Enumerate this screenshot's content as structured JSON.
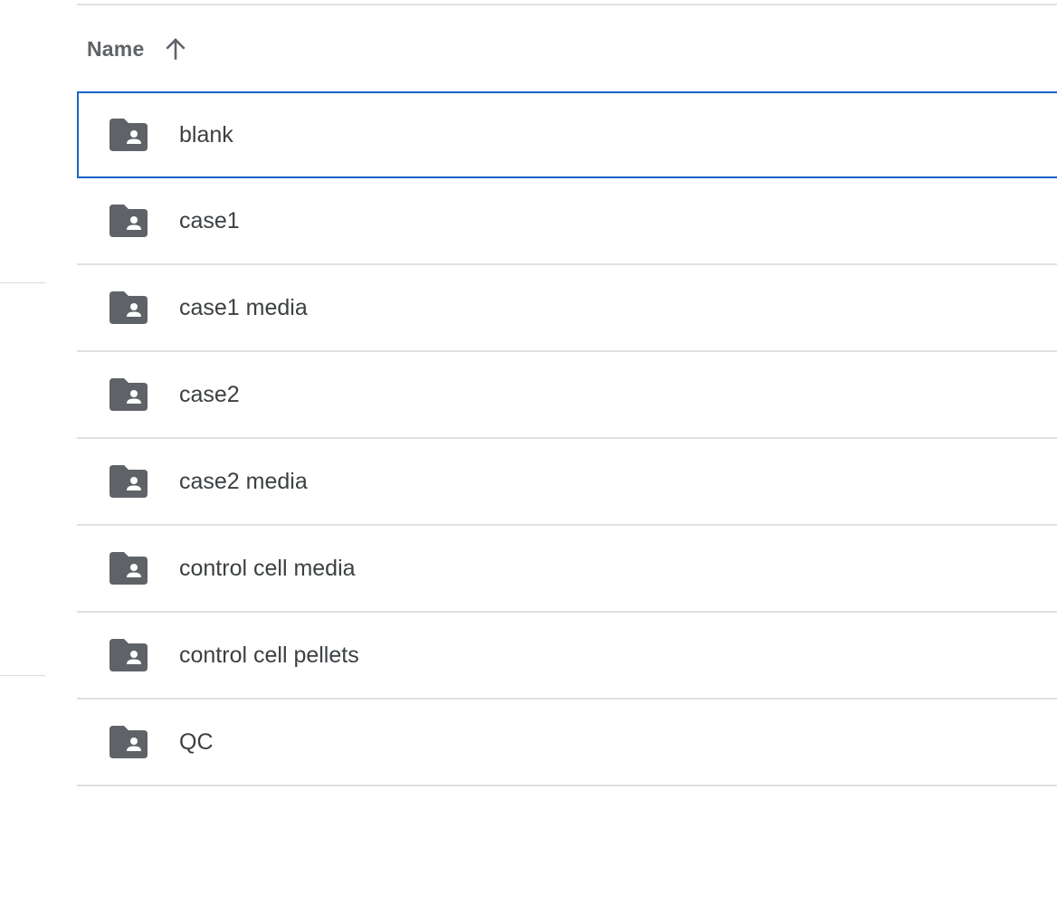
{
  "list": {
    "header": {
      "name_label": "Name",
      "sort_direction": "ascending",
      "sort_icon": "arrow-up-icon"
    },
    "folder_icon": "shared-folder-icon",
    "colors": {
      "icon": "#5f6368",
      "text": "#3c4043",
      "header_text": "#5f6368",
      "selection_border": "#1a62c8",
      "divider": "#e0e0e0"
    },
    "selected_index": 0,
    "items": [
      {
        "name": "blank"
      },
      {
        "name": "case1"
      },
      {
        "name": "case1 media"
      },
      {
        "name": "case2"
      },
      {
        "name": "case2 media"
      },
      {
        "name": "control cell media"
      },
      {
        "name": "control cell pellets"
      },
      {
        "name": "QC"
      }
    ]
  }
}
